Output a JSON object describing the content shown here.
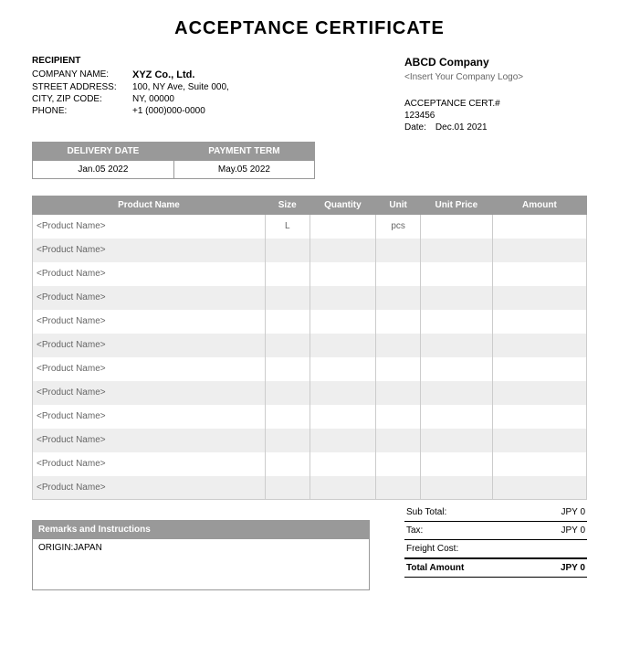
{
  "title": "ACCEPTANCE CERTIFICATE",
  "recipient": {
    "section_label": "RECIPIENT",
    "company_label": "COMPANY NAME:",
    "company_value": "XYZ Co., Ltd.",
    "street_label": "STREET ADDRESS:",
    "street_value": "100, NY Ave, Suite 000,",
    "city_label": "CITY, ZIP CODE:",
    "city_value": "NY, 00000",
    "phone_label": "PHONE:",
    "phone_value": "+1 (000)000-0000"
  },
  "company": {
    "name": "ABCD Company",
    "logo_placeholder": "<Insert Your Company Logo>",
    "cert_label": "ACCEPTANCE CERT.#",
    "cert_number": "123456",
    "date_label": "Date:",
    "date_value": "Dec.01 2021"
  },
  "delivery": {
    "delivery_date_header": "DELIVERY DATE",
    "payment_term_header": "PAYMENT TERM",
    "delivery_date": "Jan.05 2022",
    "payment_term": "May.05 2022"
  },
  "product": {
    "headers": {
      "name": "Product Name",
      "size": "Size",
      "quantity": "Quantity",
      "unit": "Unit",
      "unit_price": "Unit Price",
      "amount": "Amount"
    },
    "rows": [
      {
        "name": "<Product Name>",
        "size": "L",
        "quantity": "",
        "unit": "pcs",
        "unit_price": "",
        "amount": ""
      },
      {
        "name": "<Product Name>",
        "size": "",
        "quantity": "",
        "unit": "",
        "unit_price": "",
        "amount": ""
      },
      {
        "name": "<Product Name>",
        "size": "",
        "quantity": "",
        "unit": "",
        "unit_price": "",
        "amount": ""
      },
      {
        "name": "<Product Name>",
        "size": "",
        "quantity": "",
        "unit": "",
        "unit_price": "",
        "amount": ""
      },
      {
        "name": "<Product Name>",
        "size": "",
        "quantity": "",
        "unit": "",
        "unit_price": "",
        "amount": ""
      },
      {
        "name": "<Product Name>",
        "size": "",
        "quantity": "",
        "unit": "",
        "unit_price": "",
        "amount": ""
      },
      {
        "name": "<Product Name>",
        "size": "",
        "quantity": "",
        "unit": "",
        "unit_price": "",
        "amount": ""
      },
      {
        "name": "<Product Name>",
        "size": "",
        "quantity": "",
        "unit": "",
        "unit_price": "",
        "amount": ""
      },
      {
        "name": "<Product Name>",
        "size": "",
        "quantity": "",
        "unit": "",
        "unit_price": "",
        "amount": ""
      },
      {
        "name": "<Product Name>",
        "size": "",
        "quantity": "",
        "unit": "",
        "unit_price": "",
        "amount": ""
      },
      {
        "name": "<Product Name>",
        "size": "",
        "quantity": "",
        "unit": "",
        "unit_price": "",
        "amount": ""
      },
      {
        "name": "<Product Name>",
        "size": "",
        "quantity": "",
        "unit": "",
        "unit_price": "",
        "amount": ""
      }
    ]
  },
  "remarks": {
    "header": "Remarks and Instructions",
    "content": "ORIGIN:JAPAN"
  },
  "totals": {
    "subtotal_label": "Sub Total:",
    "subtotal_value": "JPY 0",
    "tax_label": "Tax:",
    "tax_value": "JPY 0",
    "freight_label": "Freight Cost:",
    "freight_value": "",
    "total_label": "Total Amount",
    "total_value": "JPY 0"
  }
}
